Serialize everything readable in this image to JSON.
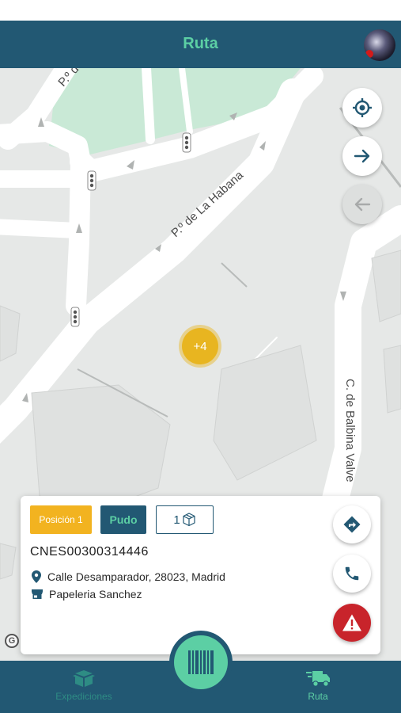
{
  "header": {
    "title": "Ruta"
  },
  "map": {
    "street_labels": [
      "P.º de La Habana",
      "C. de Balbina Valve",
      "P.º d"
    ],
    "cluster_label": "+4"
  },
  "map_controls": {
    "locate_icon": "crosshair-icon",
    "next_icon": "arrow-right-icon",
    "prev_icon": "arrow-left-icon"
  },
  "stop_card": {
    "position_label": "Posición 1",
    "type_label": "Pudo",
    "packages_count": "1",
    "tracking_code": "CNES00300314446",
    "address": "Calle Desamparador, 28023, Madrid",
    "shop_name": "Papeleria Sanchez"
  },
  "bottom_nav": {
    "items": [
      {
        "label": "Expediciones",
        "icon": "package-icon"
      },
      {
        "label": "Ruta",
        "icon": "truck-icon"
      }
    ]
  },
  "colors": {
    "primary": "#225873",
    "accent": "#5ccfa4",
    "position_chip": "#f2b320",
    "alert": "#c8242b",
    "map_bg": "#e6e8e7",
    "park": "#c9e9d6"
  }
}
